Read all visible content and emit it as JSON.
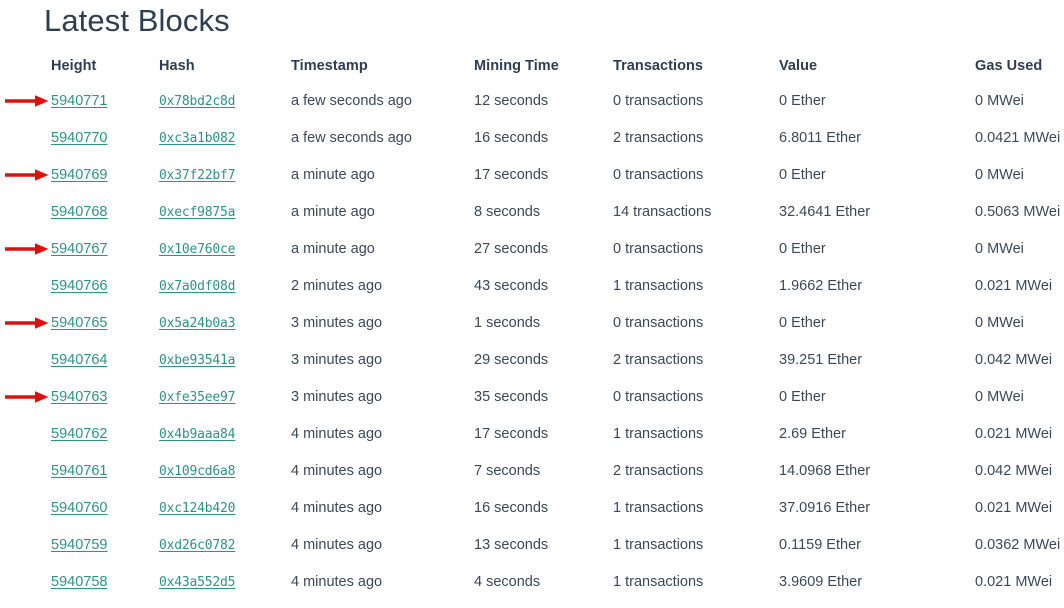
{
  "page": {
    "title": "Latest Blocks",
    "title_color": "#2f3d50",
    "background_color": "#ffffff",
    "link_color": "#2e9287",
    "text_color": "#3c4858",
    "annotation_arrow_color": "#dd1010"
  },
  "table": {
    "columns": [
      {
        "key": "height",
        "label": "Height"
      },
      {
        "key": "hash",
        "label": "Hash"
      },
      {
        "key": "timestamp",
        "label": "Timestamp"
      },
      {
        "key": "mining_time",
        "label": "Mining Time"
      },
      {
        "key": "transactions",
        "label": "Transactions"
      },
      {
        "key": "value",
        "label": "Value"
      },
      {
        "key": "gas_used",
        "label": "Gas Used"
      }
    ],
    "rows": [
      {
        "height": "5940771",
        "hash": "0x78bd2c8d",
        "timestamp": "a few seconds ago",
        "mining_time": "12 seconds",
        "transactions": "0 transactions",
        "value": "0 Ether",
        "gas_used": "0 MWei",
        "annotated": true
      },
      {
        "height": "5940770",
        "hash": "0xc3a1b082",
        "timestamp": "a few seconds ago",
        "mining_time": "16 seconds",
        "transactions": "2 transactions",
        "value": "6.8011 Ether",
        "gas_used": "0.0421 MWei",
        "annotated": false
      },
      {
        "height": "5940769",
        "hash": "0x37f22bf7",
        "timestamp": "a minute ago",
        "mining_time": "17 seconds",
        "transactions": "0 transactions",
        "value": "0 Ether",
        "gas_used": "0 MWei",
        "annotated": true
      },
      {
        "height": "5940768",
        "hash": "0xecf9875a",
        "timestamp": "a minute ago",
        "mining_time": "8 seconds",
        "transactions": "14 transactions",
        "value": "32.4641 Ether",
        "gas_used": "0.5063 MWei",
        "annotated": false
      },
      {
        "height": "5940767",
        "hash": "0x10e760ce",
        "timestamp": "a minute ago",
        "mining_time": "27 seconds",
        "transactions": "0 transactions",
        "value": "0 Ether",
        "gas_used": "0 MWei",
        "annotated": true
      },
      {
        "height": "5940766",
        "hash": "0x7a0df08d",
        "timestamp": "2 minutes ago",
        "mining_time": "43 seconds",
        "transactions": "1 transactions",
        "value": "1.9662 Ether",
        "gas_used": "0.021 MWei",
        "annotated": false
      },
      {
        "height": "5940765",
        "hash": "0x5a24b0a3",
        "timestamp": "3 minutes ago",
        "mining_time": "1 seconds",
        "transactions": "0 transactions",
        "value": "0 Ether",
        "gas_used": "0 MWei",
        "annotated": true
      },
      {
        "height": "5940764",
        "hash": "0xbe93541a",
        "timestamp": "3 minutes ago",
        "mining_time": "29 seconds",
        "transactions": "2 transactions",
        "value": "39.251 Ether",
        "gas_used": "0.042 MWei",
        "annotated": false
      },
      {
        "height": "5940763",
        "hash": "0xfe35ee97",
        "timestamp": "3 minutes ago",
        "mining_time": "35 seconds",
        "transactions": "0 transactions",
        "value": "0 Ether",
        "gas_used": "0 MWei",
        "annotated": true
      },
      {
        "height": "5940762",
        "hash": "0x4b9aaa84",
        "timestamp": "4 minutes ago",
        "mining_time": "17 seconds",
        "transactions": "1 transactions",
        "value": "2.69 Ether",
        "gas_used": "0.021 MWei",
        "annotated": false
      },
      {
        "height": "5940761",
        "hash": "0x109cd6a8",
        "timestamp": "4 minutes ago",
        "mining_time": "7 seconds",
        "transactions": "2 transactions",
        "value": "14.0968 Ether",
        "gas_used": "0.042 MWei",
        "annotated": false
      },
      {
        "height": "5940760",
        "hash": "0xc124b420",
        "timestamp": "4 minutes ago",
        "mining_time": "16 seconds",
        "transactions": "1 transactions",
        "value": "37.0916 Ether",
        "gas_used": "0.021 MWei",
        "annotated": false
      },
      {
        "height": "5940759",
        "hash": "0xd26c0782",
        "timestamp": "4 minutes ago",
        "mining_time": "13 seconds",
        "transactions": "1 transactions",
        "value": "0.1159 Ether",
        "gas_used": "0.0362 MWei",
        "annotated": false
      },
      {
        "height": "5940758",
        "hash": "0x43a552d5",
        "timestamp": "4 minutes ago",
        "mining_time": "4 seconds",
        "transactions": "1 transactions",
        "value": "3.9609 Ether",
        "gas_used": "0.021 MWei",
        "annotated": false
      }
    ]
  },
  "annotations": {
    "icon": "right-arrow-icon",
    "targets": [
      "5940771",
      "5940769",
      "5940767",
      "5940765",
      "5940763"
    ]
  }
}
